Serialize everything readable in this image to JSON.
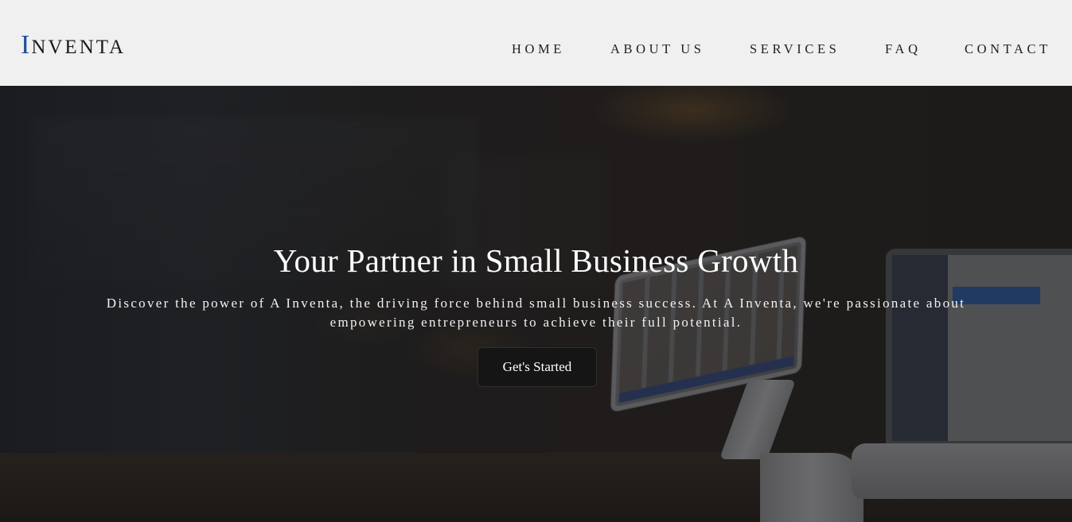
{
  "header": {
    "logo_first_letter": "I",
    "logo_rest": "NVENTA",
    "nav": [
      {
        "label": "HOME"
      },
      {
        "label": "ABOUT US"
      },
      {
        "label": "SERVICES"
      },
      {
        "label": "FAQ"
      },
      {
        "label": "CONTACT"
      }
    ]
  },
  "hero": {
    "title": "Your Partner in Small Business Growth",
    "subtitle": "Discover the power of A Inventa, the driving force behind small business success. At A Inventa, we're passionate about empowering entrepreneurs to achieve their full potential.",
    "cta_label": "Get's Started"
  },
  "colors": {
    "header_bg": "#f0f0f0",
    "logo_accent": "#1b4f9c",
    "button_bg": "#151515",
    "text_light": "#ffffff"
  }
}
